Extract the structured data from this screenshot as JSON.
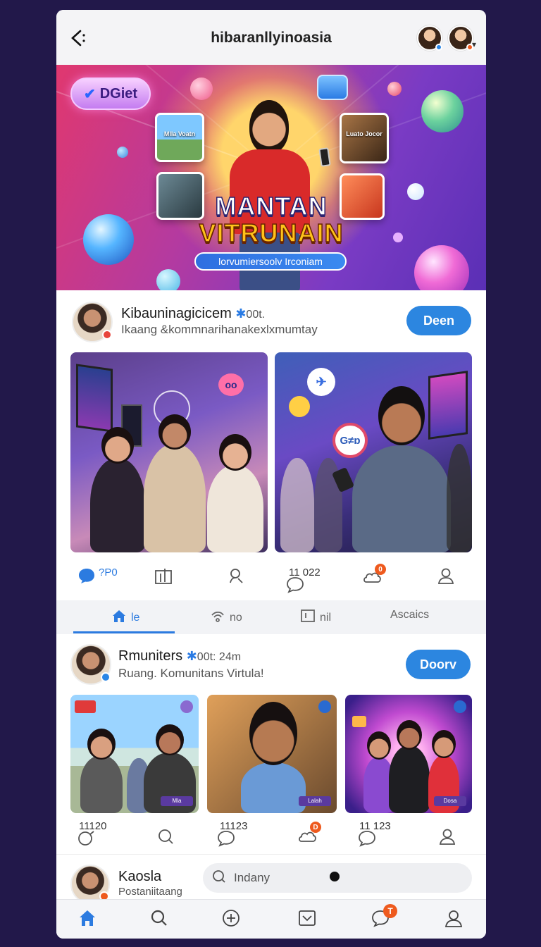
{
  "app": {
    "title": "hibaranllyinoasia"
  },
  "banner": {
    "tag_label": "DGiet",
    "title_line1": "MANTAN",
    "title_line2": "VITRUNAIN",
    "subtitle": "lorvumiersoolv Irconiam",
    "card_caption_1": "Mlla Voatn",
    "card_caption_2": "Luato Jocor"
  },
  "post1": {
    "name": "Kibauninagicicem",
    "meta": "00t.",
    "subtitle": "Ikaang &kommnarihanakexlxmumtay",
    "follow_label": "Deen",
    "bubble_text": "G≠ɒ",
    "actions": {
      "comments": "?P0",
      "replies": "11 022"
    }
  },
  "tabs": [
    {
      "label": "le",
      "icon": "home-icon"
    },
    {
      "label": "no",
      "icon": "wifi-icon"
    },
    {
      "label": "nil",
      "icon": "bracket-icon"
    },
    {
      "label": "scaics",
      "icon": "triangle-icon",
      "prefix": "A"
    }
  ],
  "post2": {
    "name": "Rmuniters",
    "meta": "00t: 24m",
    "subtitle": "Ruang. Komunitans Virtula!",
    "follow_label": "Doorv",
    "counts": [
      "11120",
      "11123",
      "11 123"
    ],
    "thumb_badges": [
      "Mla",
      "Lalah",
      "Dosa"
    ]
  },
  "post3": {
    "name": "Kaosla",
    "subtitle": "Postaniitaang",
    "search_placeholder": "Indany"
  },
  "nav": {
    "items": [
      "home-icon",
      "search-icon",
      "add-icon",
      "check-box-icon",
      "chat-icon",
      "profile-icon"
    ],
    "notification_count": "T"
  },
  "colors": {
    "accent": "#2c86e0",
    "background": "#22184a",
    "notification": "#ee5a1e"
  }
}
